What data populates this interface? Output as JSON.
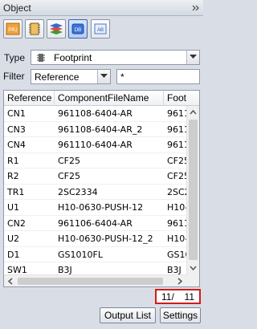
{
  "panel": {
    "title": "Object"
  },
  "icons": [
    "collapse-panel-icon",
    "project-icon",
    "component-icon",
    "layer-icon",
    "db-icon",
    "ab-icon",
    "chip-icon"
  ],
  "toolbar": {
    "prj_label": "PRJ",
    "db_label": "DB",
    "ab_label": "AB"
  },
  "type": {
    "label": "Type",
    "value": "Footprint"
  },
  "filter": {
    "label": "Filter",
    "field": "Reference",
    "value": "*"
  },
  "table": {
    "columns": [
      "Reference",
      "ComponentFileName",
      "Foot"
    ],
    "rows": [
      [
        "CN1",
        "961108-6404-AR",
        "9611"
      ],
      [
        "CN3",
        "961108-6404-AR_2",
        "9611"
      ],
      [
        "CN4",
        "961110-6404-AR",
        "9611"
      ],
      [
        "R1",
        "CF25",
        "CF25"
      ],
      [
        "R2",
        "CF25",
        "CF25"
      ],
      [
        "TR1",
        "2SC2334",
        "2SC2"
      ],
      [
        "U1",
        "H10-0630-PUSH-12",
        "H10-"
      ],
      [
        "CN2",
        "961106-6404-AR",
        "9611"
      ],
      [
        "U2",
        "H10-0630-PUSH-12_2",
        "H10-"
      ],
      [
        "D1",
        "GS1010FL",
        "GS10"
      ],
      [
        "SW1",
        "B3J",
        "B3J"
      ]
    ]
  },
  "counter": {
    "current": "11/",
    "total": "11"
  },
  "buttons": {
    "output_list": "Output List",
    "settings": "Settings"
  },
  "colors": {
    "counter_border": "#d11a1a",
    "panel_bg": "#d9dee6"
  }
}
